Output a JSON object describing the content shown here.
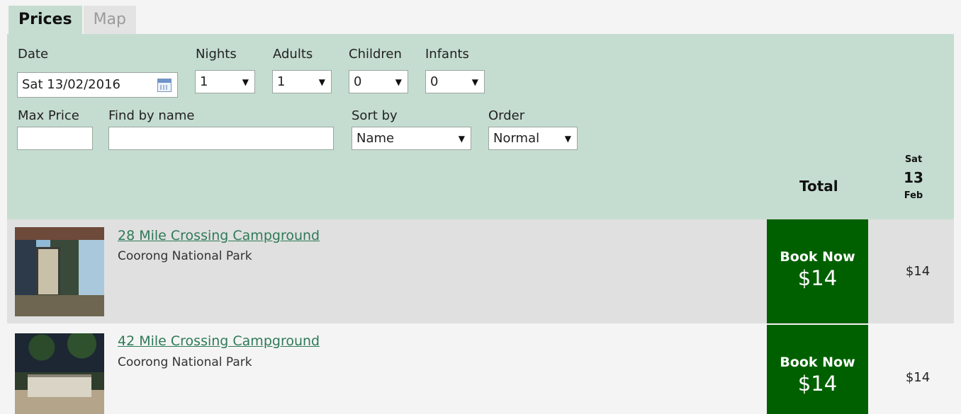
{
  "tabs": [
    {
      "label": "Prices",
      "active": true
    },
    {
      "label": "Map",
      "active": false
    }
  ],
  "filters": {
    "date": {
      "label": "Date",
      "value": "Sat 13/02/2016",
      "icon": "calendar-icon"
    },
    "nights": {
      "label": "Nights",
      "value": "1"
    },
    "adults": {
      "label": "Adults",
      "value": "1"
    },
    "children": {
      "label": "Children",
      "value": "0"
    },
    "infants": {
      "label": "Infants",
      "value": "0"
    },
    "max_price": {
      "label": "Max Price",
      "value": ""
    },
    "find_by_name": {
      "label": "Find by name",
      "value": ""
    },
    "sort_by": {
      "label": "Sort by",
      "value": "Name"
    },
    "order": {
      "label": "Order",
      "value": "Normal"
    }
  },
  "columns": {
    "total": "Total",
    "day": {
      "dow": "Sat",
      "date": "13",
      "month": "Feb"
    }
  },
  "results": [
    {
      "name": "28 Mile Crossing Campground",
      "park": "Coorong National Park",
      "book_label": "Book Now",
      "price": "$14",
      "day_price": "$14"
    },
    {
      "name": "42 Mile Crossing Campground",
      "park": "Coorong National Park",
      "book_label": "Book Now",
      "price": "$14",
      "day_price": "$14"
    }
  ],
  "colors": {
    "panel_bg": "#c5ddd0",
    "book_button": "#006000",
    "link": "#2e7a57"
  }
}
